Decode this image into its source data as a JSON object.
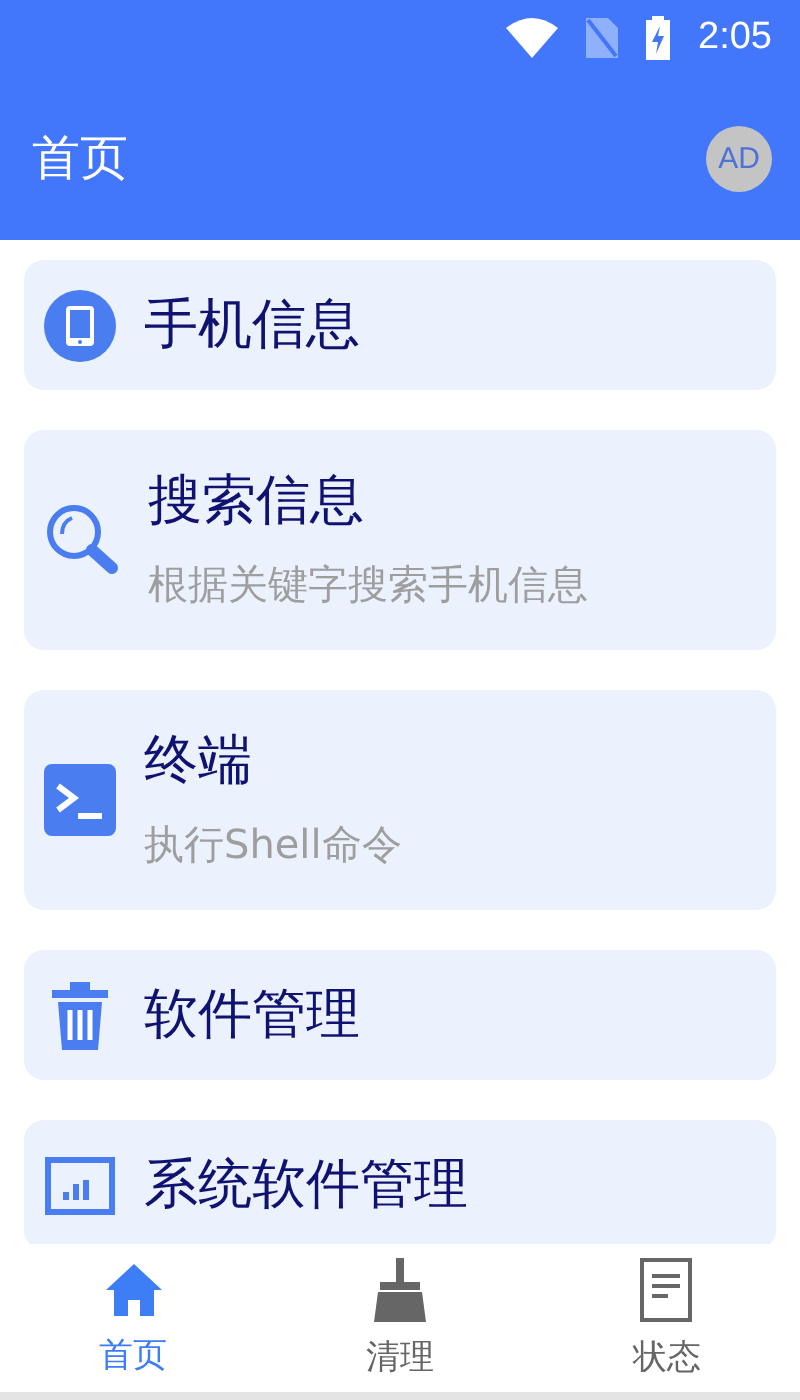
{
  "status_bar": {
    "time": "2:05"
  },
  "app_bar": {
    "title": "首页",
    "avatar": "AD"
  },
  "items": [
    {
      "title": "手机信息"
    },
    {
      "title": "搜索信息",
      "subtitle": "根据关键字搜索手机信息"
    },
    {
      "title": "终端",
      "subtitle": "执行Shell命令"
    },
    {
      "title": "软件管理"
    },
    {
      "title": "系统软件管理"
    }
  ],
  "bottom_nav": [
    {
      "label": "首页",
      "selected": true
    },
    {
      "label": "清理",
      "selected": false
    },
    {
      "label": "状态",
      "selected": false
    }
  ]
}
